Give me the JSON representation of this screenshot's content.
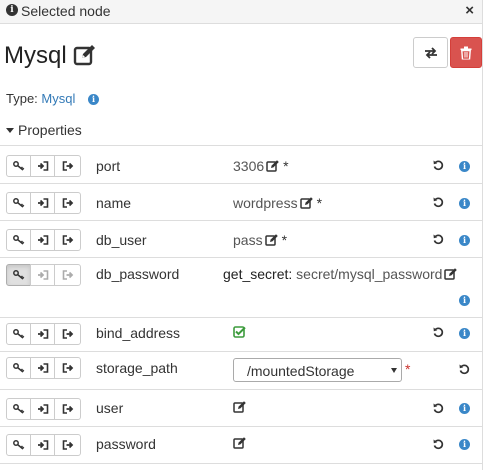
{
  "panel": {
    "title": "Selected node",
    "close_glyph": "×"
  },
  "node": {
    "name": "Mysql"
  },
  "type": {
    "label": "Type:",
    "value": "Mysql"
  },
  "properties": {
    "heading": "Properties",
    "rows": [
      {
        "name": "port",
        "value": "3306",
        "required": "*"
      },
      {
        "name": "name",
        "value": "wordpress",
        "required": "*"
      },
      {
        "name": "db_user",
        "value": "pass",
        "required": "*"
      },
      {
        "name": "db_password",
        "function": "get_secret:",
        "value": "secret/mysql_password"
      },
      {
        "name": "bind_address",
        "value_icon": "check-square-icon"
      },
      {
        "name": "storage_path",
        "value": "/mountedStorage",
        "required": "*"
      },
      {
        "name": "user"
      },
      {
        "name": "password"
      }
    ]
  },
  "icons": {
    "button_group": [
      "key-icon",
      "sign-in-icon",
      "sign-out-icon"
    ],
    "actions": [
      "swap-icon",
      "trash-icon"
    ],
    "row_actions": [
      "reset-icon",
      "info-icon"
    ]
  },
  "colors": {
    "link": "#337ab7",
    "danger": "#d9534f",
    "info": "#3a87c8",
    "check": "#3c9b3c"
  }
}
